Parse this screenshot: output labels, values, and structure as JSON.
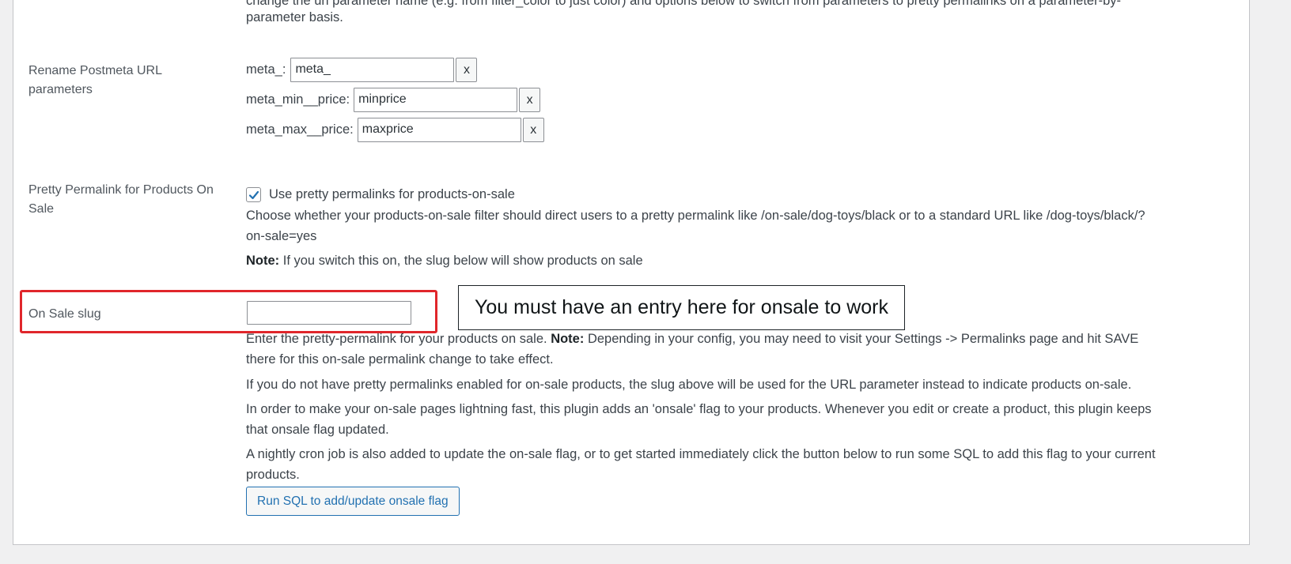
{
  "top_text": {
    "line1": "change the url parameter name (e.g. from filter_color to just color) and options below to switch from parameters to pretty permalinks on a parameter-by-",
    "line2": "parameter basis."
  },
  "postmeta": {
    "label_line1": "Rename Postmeta URL",
    "label_line2": "parameters",
    "fields": [
      {
        "label": "meta_:",
        "value": "meta_",
        "remove": "x"
      },
      {
        "label": "meta_min__price:",
        "value": "minprice",
        "remove": "x"
      },
      {
        "label": "meta_max__price:",
        "value": "maxprice",
        "remove": "x"
      }
    ]
  },
  "pretty_onsale": {
    "label_line1": "Pretty Permalink for Products On",
    "label_line2": "Sale",
    "checkbox_label": "Use pretty permalinks for products-on-sale",
    "checked": true,
    "desc_line1": "Choose whether your products-on-sale filter should direct users to a pretty permalink like /on-sale/dog-toys/black or to a standard URL like /dog-toys/black/?",
    "desc_line2": "on-sale=yes",
    "note_label": "Note:",
    "note_text": " If you switch this on, the slug below will show products on sale"
  },
  "onsale_slug": {
    "label": "On Sale slug",
    "value": "",
    "callout": "You must have an entry here for onsale to work",
    "p1_line1_a": "Enter the pretty-permalink for your products on sale. ",
    "p1_note": "Note:",
    "p1_line1_b": " Depending in your config, you may need to visit your Settings -> Permalinks page and hit SAVE",
    "p1_line2": "there for this on-sale permalink change to take effect.",
    "p2": "If you do not have pretty permalinks enabled for on-sale products, the slug above will be used for the URL parameter instead to indicate products on-sale.",
    "p3_line1": "In order to make your on-sale pages lightning fast, this plugin adds an 'onsale' flag to your products. Whenever you edit or create a product, this plugin keeps",
    "p3_line2": "that onsale flag updated.",
    "p4_line1": "A nightly cron job is also added to update the on-sale flag, or to get started immediately click the button below to run some SQL to add this flag to your current",
    "p4_line2": "products.",
    "run_button": "Run SQL to add/update onsale flag"
  },
  "colors": {
    "highlight": "#e0262b",
    "button_accent": "#2271b1",
    "checkbox_tick": "#2271b1"
  }
}
